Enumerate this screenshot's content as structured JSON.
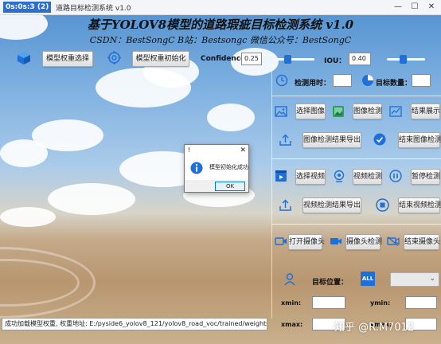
{
  "window": {
    "app_badge": "0s:0s:3 (2)",
    "title": "道路目标检测系统 v1.0",
    "minimize": "—",
    "maximize": "☐",
    "close": "✕"
  },
  "header": {
    "title": "基于YOLOV8模型的道路瑕疵目标检测系统 v1.0",
    "subtitle": "CSDN：BestSongC   B站：Bestsongc   微信公众号：BestSongC"
  },
  "toolbar": {
    "select_weights": "模型权重选择",
    "init_weights": "模型权重初始化",
    "confidence_label": "Confidence",
    "confidence_value": "0.25",
    "confidence_level": 0.25,
    "iou_label": "IOU：",
    "iou_value": "0.40",
    "iou_level": 0.4
  },
  "stats": {
    "time_label": "检测用时：",
    "time_value": "",
    "count_label": "目标数量：",
    "count_value": ""
  },
  "image_section": {
    "select": "选择图像",
    "detect": "图像检测",
    "show": "结果展示",
    "export": "图像检测结果导出",
    "stop": "结束图像检测"
  },
  "video_section": {
    "select": "选择视频",
    "detect": "视频检测",
    "pause": "暂停检测",
    "export": "视频检测结果导出",
    "stop": "结束视频检测"
  },
  "camera_section": {
    "open": "打开摄像头",
    "detect": "摄像头检测",
    "stop": "结束摄像头"
  },
  "target": {
    "position_label": "目标位置：",
    "all_label": "ALL",
    "combo_value": "",
    "xmin_label": "xmin:",
    "ymin_label": "ymin:",
    "xmax_label": "xmax:",
    "ymax_label": "ymax:"
  },
  "status": {
    "text": "成功加载模型权重, 权重地址: E:/pyside6_yolov8_121/yolov8_road_voc/trained/weights/best.pt"
  },
  "dialog": {
    "title": "!",
    "close": "✕",
    "message": "模型初始化成功",
    "ok": "OK"
  },
  "watermark": {
    "text": "知乎 @R.M7012"
  },
  "colors": {
    "accent": "#1e6fd9",
    "title_badge": "#2b6fd1"
  }
}
